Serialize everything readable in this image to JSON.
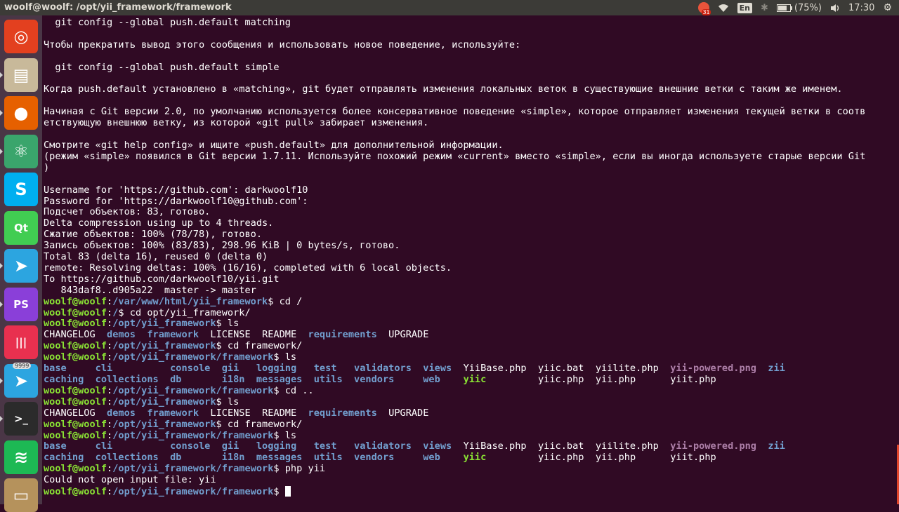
{
  "topbar": {
    "title": "woolf@woolf: /opt/yii_framework/framework",
    "chrome_badge": "31",
    "language": "En",
    "battery": "(75%)",
    "clock": "17:30"
  },
  "launcher": {
    "items": [
      {
        "name": "ubuntu-dash-icon",
        "color": "#e3401f"
      },
      {
        "name": "files-icon",
        "color": "#c8b99a"
      },
      {
        "name": "firefox-icon",
        "color": "#e66000"
      },
      {
        "name": "atom-icon",
        "color": "#3aa56c"
      },
      {
        "name": "skype-icon",
        "color": "#00aff0"
      },
      {
        "name": "qt-creator-icon",
        "color": "#41cd52"
      },
      {
        "name": "telegram-icon",
        "color": "#2ca5e0"
      },
      {
        "name": "phpstorm-icon",
        "color": "#8a3fd9"
      },
      {
        "name": "app-red-icon",
        "color": "#e8304f"
      },
      {
        "name": "telegram-desktop-icon",
        "color": "#2ca5e0",
        "badge": "9999"
      },
      {
        "name": "terminal-icon",
        "color": "#2b2b2b"
      },
      {
        "name": "spotify-icon",
        "color": "#1db954"
      },
      {
        "name": "scanner-icon",
        "color": "#b5925c"
      }
    ]
  },
  "terminal": {
    "lines": [
      {
        "t": "  git config --global push.default matching"
      },
      {
        "t": ""
      },
      {
        "t": "Чтобы прекратить вывод этого сообщения и использовать новое поведение, используйте:"
      },
      {
        "t": ""
      },
      {
        "t": "  git config --global push.default simple"
      },
      {
        "t": ""
      },
      {
        "t": "Когда push.default установлено в «matching», git будет отправлять изменения локальных веток в существующие внешние ветки с таким же именем."
      },
      {
        "t": ""
      },
      {
        "t": "Начиная с Git версии 2.0, по умолчанию используется более консервативное поведение «simple», которое отправляет изменения текущей ветки в соотв"
      },
      {
        "t": "етствующую внешнюю ветку, из которой «git pull» забирает изменения."
      },
      {
        "t": ""
      },
      {
        "t": "Смотрите «git help config» и ищите «push.default» для дополнительной информации."
      },
      {
        "t": "(режим «simple» появился в Git версии 1.7.11. Используйте похожий режим «current» вместо «simple», если вы иногда используете старые версии Git"
      },
      {
        "t": ")"
      },
      {
        "t": ""
      },
      {
        "t": "Username for 'https://github.com': darkwoolf10"
      },
      {
        "t": "Password for 'https://darkwoolf10@github.com':"
      },
      {
        "t": "Подсчет объектов: 83, готово."
      },
      {
        "t": "Delta compression using up to 4 threads."
      },
      {
        "t": "Сжатие объектов: 100% (78/78), готово."
      },
      {
        "t": "Запись объектов: 100% (83/83), 298.96 KiB | 0 bytes/s, готово."
      },
      {
        "t": "Total 83 (delta 16), reused 0 (delta 0)"
      },
      {
        "t": "remote: Resolving deltas: 100% (16/16), completed with 6 local objects."
      },
      {
        "t": "To https://github.com/darkwoolf10/yii.git"
      },
      {
        "t": "   843daf8..d905a22  master -> master"
      },
      {
        "p": true,
        "path": "/var/www/html/yii_framework",
        "cmd": " cd /"
      },
      {
        "p": true,
        "path": "/",
        "cmd": " cd opt/yii_framework/"
      },
      {
        "p": true,
        "path": "/opt/yii_framework",
        "cmd": " ls"
      },
      {
        "ls": 1
      },
      {
        "p": true,
        "path": "/opt/yii_framework",
        "cmd": " cd framework/"
      },
      {
        "p": true,
        "path": "/opt/yii_framework/framework",
        "cmd": " ls"
      },
      {
        "ls": 2
      },
      {
        "ls": 3
      },
      {
        "p": true,
        "path": "/opt/yii_framework/framework",
        "cmd": " cd .."
      },
      {
        "p": true,
        "path": "/opt/yii_framework",
        "cmd": " ls"
      },
      {
        "ls": 1
      },
      {
        "p": true,
        "path": "/opt/yii_framework",
        "cmd": " cd framework/"
      },
      {
        "p": true,
        "path": "/opt/yii_framework/framework",
        "cmd": " ls"
      },
      {
        "ls": 2
      },
      {
        "ls": 3
      },
      {
        "p": true,
        "path": "/opt/yii_framework/framework",
        "cmd": " php yii"
      },
      {
        "t": "Could not open input file: yii"
      },
      {
        "p": true,
        "path": "/opt/yii_framework/framework",
        "cmd": " ",
        "cursor": true
      }
    ],
    "prompt_user": "woolf@woolf",
    "prompt_sep": ":",
    "prompt_end": "$",
    "ls_root": [
      {
        "n": "CHANGELOG",
        "c": ""
      },
      {
        "n": "  "
      },
      {
        "n": "demos",
        "c": "b"
      },
      {
        "n": "  "
      },
      {
        "n": "framework",
        "c": "b"
      },
      {
        "n": "  "
      },
      {
        "n": "LICENSE",
        "c": ""
      },
      {
        "n": "  "
      },
      {
        "n": "README",
        "c": ""
      },
      {
        "n": "  "
      },
      {
        "n": "requirements",
        "c": "b"
      },
      {
        "n": "  "
      },
      {
        "n": "UPGRADE",
        "c": ""
      }
    ],
    "ls_fw_row1": [
      {
        "n": "base",
        "c": "b"
      },
      {
        "n": "     "
      },
      {
        "n": "cli",
        "c": "b"
      },
      {
        "n": "          "
      },
      {
        "n": "console",
        "c": "b"
      },
      {
        "n": "  "
      },
      {
        "n": "gii",
        "c": "b"
      },
      {
        "n": "   "
      },
      {
        "n": "logging",
        "c": "b"
      },
      {
        "n": "   "
      },
      {
        "n": "test",
        "c": "b"
      },
      {
        "n": "   "
      },
      {
        "n": "validators",
        "c": "b"
      },
      {
        "n": "  "
      },
      {
        "n": "views",
        "c": "b"
      },
      {
        "n": "  "
      },
      {
        "n": "YiiBase.php",
        "c": ""
      },
      {
        "n": "  "
      },
      {
        "n": "yiic.bat",
        "c": ""
      },
      {
        "n": "  "
      },
      {
        "n": "yiilite.php",
        "c": ""
      },
      {
        "n": "  "
      },
      {
        "n": "yii-powered.png",
        "c": "m"
      },
      {
        "n": "  "
      },
      {
        "n": "zii",
        "c": "b"
      }
    ],
    "ls_fw_row2": [
      {
        "n": "caching",
        "c": "b"
      },
      {
        "n": "  "
      },
      {
        "n": "collections",
        "c": "b"
      },
      {
        "n": "  "
      },
      {
        "n": "db",
        "c": "b"
      },
      {
        "n": "       "
      },
      {
        "n": "i18n",
        "c": "b"
      },
      {
        "n": "  "
      },
      {
        "n": "messages",
        "c": "b"
      },
      {
        "n": "  "
      },
      {
        "n": "utils",
        "c": "b"
      },
      {
        "n": "  "
      },
      {
        "n": "vendors",
        "c": "b"
      },
      {
        "n": "     "
      },
      {
        "n": "web",
        "c": "b"
      },
      {
        "n": "    "
      },
      {
        "n": "yiic",
        "c": "bg"
      },
      {
        "n": "         "
      },
      {
        "n": "yiic.php",
        "c": ""
      },
      {
        "n": "  "
      },
      {
        "n": "yii.php",
        "c": ""
      },
      {
        "n": "      "
      },
      {
        "n": "yiit.php",
        "c": ""
      }
    ]
  }
}
